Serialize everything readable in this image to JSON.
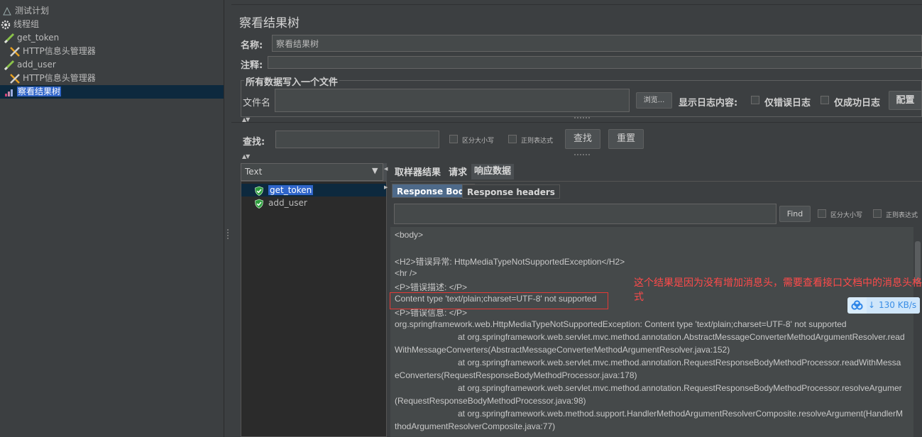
{
  "tree": {
    "items": [
      {
        "label": "测试计划",
        "icon": "test-plan-icon"
      },
      {
        "label": "线程组",
        "icon": "gear-icon"
      },
      {
        "label": "get_token",
        "icon": "http-sampler-icon"
      },
      {
        "label": "HTTP信息头管理器",
        "icon": "tools-icon"
      },
      {
        "label": "add_user",
        "icon": "http-sampler-icon"
      },
      {
        "label": "HTTP信息头管理器",
        "icon": "tools-icon"
      },
      {
        "label": "察看结果树",
        "icon": "results-tree-icon"
      }
    ]
  },
  "panel": {
    "title": "察看结果树",
    "name_label": "名称:",
    "name_value": "察看结果树",
    "comment_label": "注释:",
    "comment_value": "",
    "file_group_title": "所有数据写入一个文件",
    "filename_label": "文件名",
    "filename_value": "",
    "browse_label": "浏览...",
    "log_display_label": "显示日志内容:",
    "errors_only_label": "仅错误日志",
    "success_only_label": "仅成功日志",
    "configure_label": "配置"
  },
  "search": {
    "label": "查找:",
    "value": "",
    "case_label": "区分大小写",
    "regex_label": "正则表达式",
    "find_label": "查找",
    "reset_label": "重置"
  },
  "results": {
    "renderer": "Text",
    "items": [
      {
        "label": "get_token",
        "status": "success"
      },
      {
        "label": "add_user",
        "status": "success"
      }
    ]
  },
  "tabs": [
    "取样器结果",
    "请求",
    "响应数据"
  ],
  "subtabs": [
    "Response Body",
    "Response headers"
  ],
  "body_search": {
    "find_label": "Find",
    "case_label": "区分大小写",
    "regex_label": "正则表达式"
  },
  "response_lines": [
    "<body>",
    "",
    "<H2>错误异常: HttpMediaTypeNotSupportedException</H2>",
    "<hr />",
    "<P>错误描述: </P>",
    "Content type 'text/plain;charset=UTF-8' not supported",
    "<P>错误信息: </P>",
    "org.springframework.web.HttpMediaTypeNotSupportedException: Content type 'text/plain;charset=UTF-8' not supported",
    "at org.springframework.web.servlet.mvc.method.annotation.AbstractMessageConverterMethodArgumentResolver.read",
    "WithMessageConverters(AbstractMessageConverterMethodArgumentResolver.java:152)",
    "at org.springframework.web.servlet.mvc.method.annotation.RequestResponseBodyMethodProcessor.readWithMessa",
    "eConverters(RequestResponseBodyMethodProcessor.java:178)",
    "at org.springframework.web.servlet.mvc.method.annotation.RequestResponseBodyMethodProcessor.resolveArgumer",
    "(RequestResponseBodyMethodProcessor.java:98)",
    "at org.springframework.web.method.support.HandlerMethodArgumentResolverComposite.resolveArgument(HandlerM",
    "thodArgumentResolverComposite.java:77)"
  ],
  "annotation": "这个结果是因为没有增加消息头，需要查看接口文档中的消息头格式",
  "speed_badge": "130 KB/s",
  "colors": {
    "accent": "#2f65ca",
    "annotation": "#ff4a4a",
    "success": "#2e9e3e"
  }
}
